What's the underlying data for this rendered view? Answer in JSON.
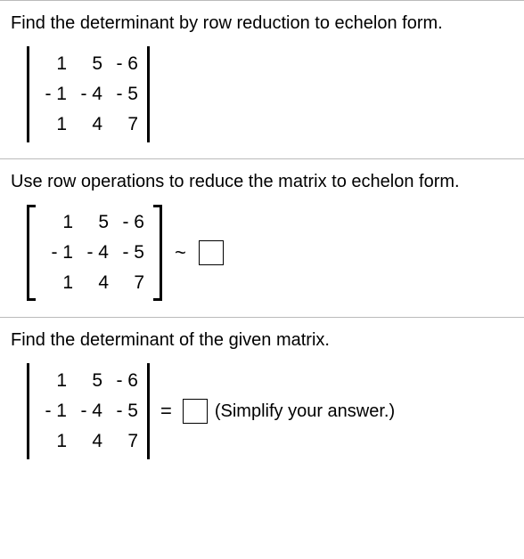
{
  "section1": {
    "prompt": "Find the determinant by row reduction to echelon form.",
    "matrix": [
      [
        "1",
        "5",
        "- 6"
      ],
      [
        "- 1",
        "- 4",
        "- 5"
      ],
      [
        "1",
        "4",
        "7"
      ]
    ]
  },
  "section2": {
    "prompt": "Use row operations to reduce the matrix to echelon form.",
    "matrix": [
      [
        "1",
        "5",
        "- 6"
      ],
      [
        "- 1",
        "- 4",
        "- 5"
      ],
      [
        "1",
        "4",
        "7"
      ]
    ],
    "tilde": "~"
  },
  "section3": {
    "prompt": "Find the determinant of the given matrix.",
    "matrix": [
      [
        "1",
        "5",
        "- 6"
      ],
      [
        "- 1",
        "- 4",
        "- 5"
      ],
      [
        "1",
        "4",
        "7"
      ]
    ],
    "eq": "=",
    "note": "(Simplify your answer.)"
  }
}
